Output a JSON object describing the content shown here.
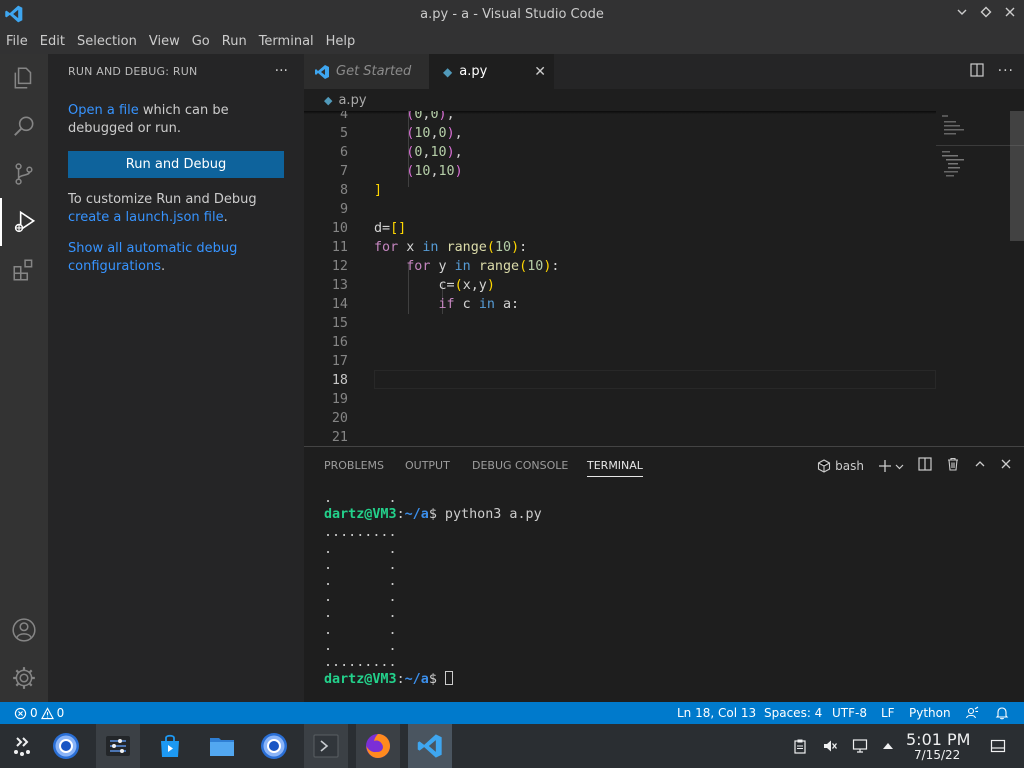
{
  "window": {
    "title": "a.py - a - Visual Studio Code"
  },
  "menu": [
    "File",
    "Edit",
    "Selection",
    "View",
    "Go",
    "Run",
    "Terminal",
    "Help"
  ],
  "sidebar": {
    "header": "RUN AND DEBUG: RUN",
    "more": "···",
    "open_link": "Open a file",
    "open_rest": " which can be debugged or run.",
    "run_button": "Run and Debug",
    "customize_text": "To customize Run and Debug ",
    "launch_link": "create a launch.json file",
    "launch_rest": ".",
    "show_link": "Show all automatic debug configurations",
    "show_rest": "."
  },
  "tabs": {
    "get_started": "Get Started",
    "active": "a.py"
  },
  "breadcrumb": "a.py",
  "editor": {
    "line_numbers": [
      "4",
      "5",
      "6",
      "7",
      "8",
      "9",
      "10",
      "11",
      "12",
      "13",
      "14",
      "15",
      "16",
      "17",
      "18",
      "19",
      "20",
      "21"
    ],
    "current_line": "18"
  },
  "panel": {
    "tabs": [
      "PROBLEMS",
      "OUTPUT",
      "DEBUG CONSOLE",
      "TERMINAL"
    ],
    "shell": "bash",
    "terminal": {
      "line0": ".       .",
      "user": "dartz@VM3",
      "colon": ":",
      "path": "~/a",
      "command": "$ python3 a.py",
      "prompt_end": "$ ",
      "out": [
        ".........",
        ".       .",
        ".       .",
        ".       .",
        ".       .",
        ".       .",
        ".       .",
        ".       .",
        "........."
      ]
    }
  },
  "status": {
    "errors": "0",
    "warnings": "0",
    "position": "Ln 18, Col 13",
    "spaces": "Spaces: 4",
    "encoding": "UTF-8",
    "eol": "LF",
    "language": "Python"
  },
  "clock": {
    "time": "5:01 PM",
    "date": "7/15/22"
  },
  "colors": {
    "accent": "#007acc",
    "button": "#0e639c",
    "link": "#3794ff"
  }
}
